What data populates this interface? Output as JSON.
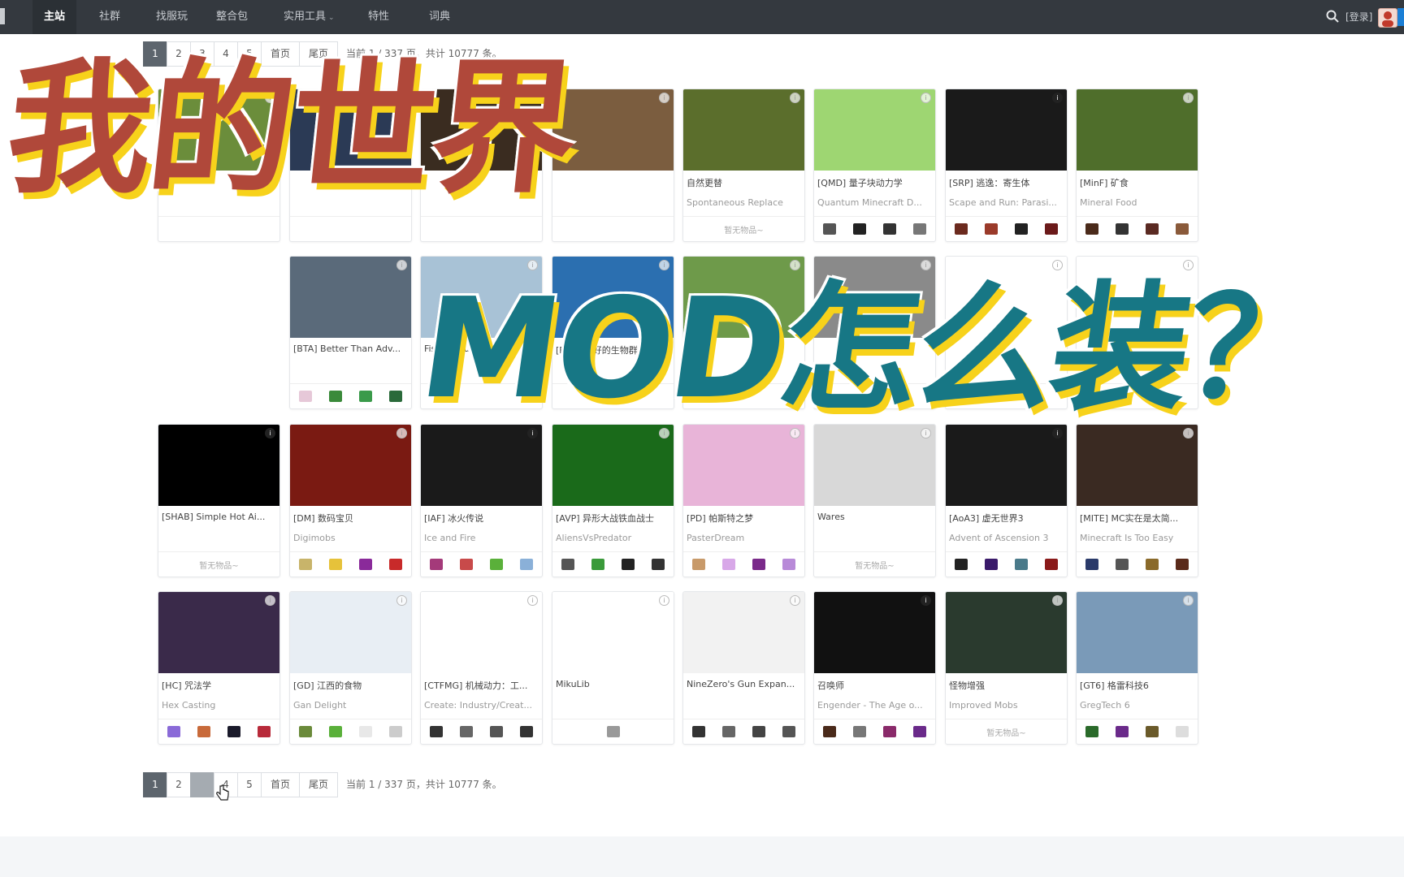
{
  "nav": {
    "items": [
      {
        "label": "主站",
        "active": true
      },
      {
        "label": "社群"
      },
      {
        "label": "找服玩"
      },
      {
        "label": "整合包"
      },
      {
        "label": "实用工具",
        "dropdown": true
      },
      {
        "label": "特性"
      },
      {
        "label": "词典"
      }
    ],
    "search_icon": "search-icon",
    "login_label": "[登录]"
  },
  "pagination": {
    "pages": [
      "1",
      "2",
      "3",
      "4",
      "5"
    ],
    "active_page": "1",
    "first_label": "首页",
    "last_label": "尾页",
    "info": "当前 1 / 337 页，共计 10777 条。"
  },
  "empty_items_label": "暂无物品~",
  "cards": [
    {
      "title": "",
      "subtitle": "",
      "thumb": "#6b8d3b",
      "items": []
    },
    {
      "title": "",
      "subtitle": "",
      "thumb": "#2b3a55",
      "items": []
    },
    {
      "title": "",
      "subtitle": "",
      "thumb": "#3a2c20",
      "items": []
    },
    {
      "title": "",
      "subtitle": "",
      "thumb": "#7b5d3f",
      "items": []
    },
    {
      "title": "自然更替",
      "subtitle": "Spontaneous Replace",
      "thumb": "#5b6e2c",
      "items": [],
      "empty": true
    },
    {
      "title": "[QMD] 量子块动力学",
      "subtitle": "Quantum Minecraft D...",
      "thumb": "#9ed672",
      "items": [
        "#555",
        "#222",
        "#333",
        "#777"
      ]
    },
    {
      "title": "[SRP] 逃逸：寄生体",
      "subtitle": "Scape and Run: Parasi...",
      "thumb": "#1a1a1a",
      "items": [
        "#6b2a1e",
        "#9a3a2a",
        "#222",
        "#6b1a1a"
      ]
    },
    {
      "title": "[MinF] 矿食",
      "subtitle": "Mineral Food",
      "thumb": "#4f6e2b",
      "items": [
        "#4a2a1a",
        "#333",
        "#5a2a22",
        "#8a5a3a"
      ]
    },
    {
      "title": "[BTA] Better Than Adv...",
      "subtitle": "",
      "thumb": "#5a6a7a",
      "items": [
        "#e6c8d8",
        "#3a8a3a",
        "#3a9a4a",
        "#2a6a3a"
      ]
    },
    {
      "title": "Fishing Ruler",
      "subtitle": "",
      "thumb": "#a8c2d6",
      "items": []
    },
    {
      "title": "[BBA] 更好的生物群系",
      "subtitle": "",
      "thumb": "#2b6fb0",
      "items": []
    },
    {
      "title": "",
      "subtitle": "",
      "thumb": "#6e9a4a",
      "items": []
    },
    {
      "title": "",
      "subtitle": "",
      "thumb": "#8a8a8a",
      "items": []
    },
    {
      "title": "",
      "subtitle": "",
      "thumb": "#ffffff",
      "items": []
    },
    {
      "title": "",
      "subtitle": "",
      "thumb": "#ffffff",
      "items": []
    },
    {
      "title": "[SHAB] Simple Hot Ai...",
      "subtitle": "",
      "thumb": "#000000",
      "items": [],
      "empty": true
    },
    {
      "title": "[DM] 数码宝贝",
      "subtitle": "Digimobs",
      "thumb": "#7a1a12",
      "items": [
        "#c8b46a",
        "#e6c23a",
        "#8a2a9a",
        "#c82a2a"
      ]
    },
    {
      "title": "[IAF] 冰火传说",
      "subtitle": "Ice and Fire",
      "thumb": "#1a1a1a",
      "items": [
        "#a43a7a",
        "#c84a4a",
        "#5ab03a",
        "#8ab0d8"
      ]
    },
    {
      "title": "[AVP] 异形大战铁血战士",
      "subtitle": "AliensVsPredator",
      "thumb": "#1a6a1a",
      "items": [
        "#555",
        "#3a9a3a",
        "#222",
        "#333"
      ]
    },
    {
      "title": "[PD] 帕斯特之梦",
      "subtitle": "PasterDream",
      "thumb": "#e8b4d8",
      "items": [
        "#c89a6a",
        "#d8a8e8",
        "#7a2a8a",
        "#b88ad8"
      ]
    },
    {
      "title": "Wares",
      "subtitle": "",
      "thumb": "#d8d8d8",
      "items": [],
      "empty": true
    },
    {
      "title": "[AoA3] 虚无世界3",
      "subtitle": "Advent of Ascension 3",
      "thumb": "#1a1a1a",
      "items": [
        "#222",
        "#3a1a6a",
        "#4a7a8a",
        "#8a1a1a"
      ]
    },
    {
      "title": "[MITE] MC实在是太简...",
      "subtitle": "Minecraft Is Too Easy",
      "thumb": "#3a2a22",
      "items": [
        "#2a3a6a",
        "#555",
        "#8a6a2a",
        "#5a2a1a"
      ]
    },
    {
      "title": "[HC] 咒法学",
      "subtitle": "Hex Casting",
      "thumb": "#3a2a4a",
      "items": [
        "#8a6ad8",
        "#c86a3a",
        "#1a1a2a",
        "#b82a3a"
      ]
    },
    {
      "title": "[GD] 江西的食物",
      "subtitle": "Gan Delight",
      "thumb": "#e8eef4",
      "items": [
        "#6a8a3a",
        "#5ab03a",
        "#e8e8e8",
        "#cccccc"
      ]
    },
    {
      "title": "[CTFMG] 机械动力：工...",
      "subtitle": "Create: Industry/Creat...",
      "thumb": "#ffffff",
      "items": [
        "#333",
        "#666",
        "#555",
        "#333"
      ]
    },
    {
      "title": "MikuLib",
      "subtitle": "",
      "thumb": "#ffffff",
      "items": [
        "#999"
      ]
    },
    {
      "title": "NineZero's Gun Expan...",
      "subtitle": "",
      "thumb": "#f2f2f2",
      "items": [
        "#333",
        "#666",
        "#444",
        "#555"
      ]
    },
    {
      "title": "召唤师",
      "subtitle": "Engender - The Age o...",
      "thumb": "#111111",
      "items": [
        "#4a2a1a",
        "#777",
        "#8a2a6a",
        "#6a2a8a"
      ]
    },
    {
      "title": "怪物增强",
      "subtitle": "Improved Mobs",
      "thumb": "#2a3a2e",
      "items": [],
      "empty": true
    },
    {
      "title": "[GT6] 格雷科技6",
      "subtitle": "GregTech 6",
      "thumb": "#7a9ab8",
      "items": [
        "#2a6a2a",
        "#6a2a8a",
        "#6a5a2a",
        "#dddddd"
      ]
    }
  ],
  "overlay": {
    "line1": "我的世界",
    "line2": "MOD怎么装？"
  }
}
